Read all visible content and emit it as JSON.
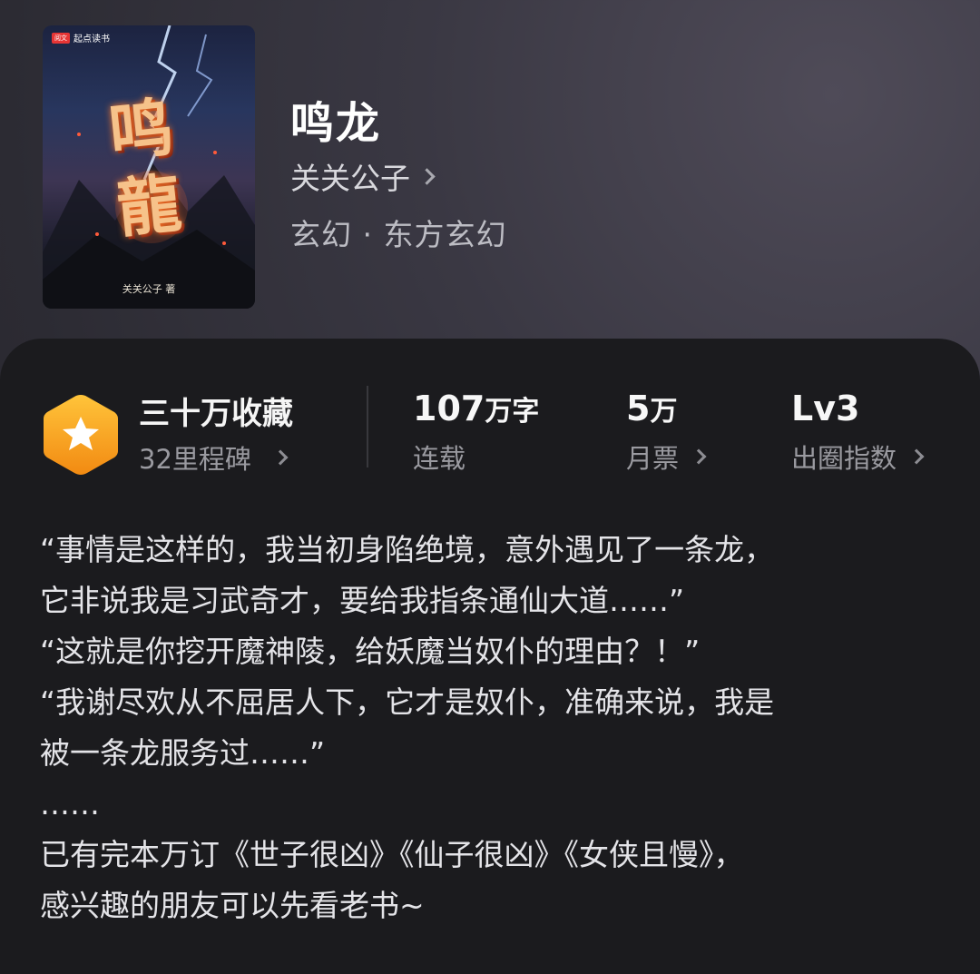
{
  "book": {
    "title": "鸣龙",
    "author": "关关公子",
    "genre": "玄幻 · 东方玄幻",
    "cover": {
      "brand": "起点读书",
      "brand_badge": "阅文",
      "title_art": "鸣龍",
      "author_signature": "关关公子 著"
    }
  },
  "stats": {
    "collection": {
      "title": "三十万收藏",
      "sub": "32里程碑"
    },
    "words": {
      "value": "107",
      "unit": "万字",
      "label": "连载"
    },
    "monthly_votes": {
      "value": "5",
      "unit": "万",
      "label": "月票"
    },
    "influence": {
      "value": "Lv3",
      "label": "出圈指数"
    }
  },
  "description": {
    "lines": [
      "“事情是这样的，我当初身陷绝境，意外遇见了一条龙，",
      "它非说我是习武奇才，要给我指条通仙大道……”",
      "“这就是你挖开魔神陵，给妖魔当奴仆的理由？！”",
      "“我谢尽欢从不屈居人下，它才是奴仆，准确来说，我是",
      "被一条龙服务过……”",
      "……",
      "已有完本万订《世子很凶》《仙子很凶》《女侠且慢》，",
      "感兴趣的朋友可以先看老书~"
    ]
  },
  "colors": {
    "accent_badge": "#f7a51c",
    "card_bg": "#1b1b1e"
  },
  "icons": {
    "collection_badge": "star-hexagon-icon",
    "link_arrow": "chevron-right-icon"
  }
}
